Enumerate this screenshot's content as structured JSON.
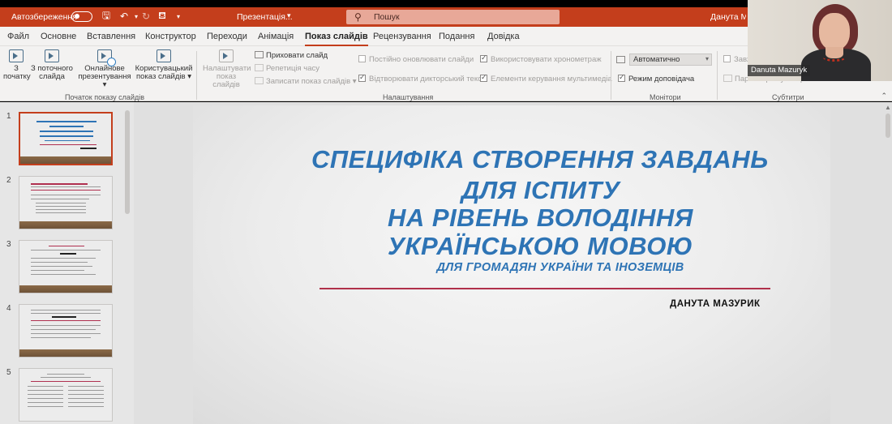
{
  "titlebar": {
    "autosave_label": "Автозбереження",
    "doc_title": "Презентація...",
    "doc_caret": "▾",
    "search_placeholder": "Пошук",
    "user_name": "Данута Мазурик"
  },
  "tabs": [
    {
      "label": "Файл"
    },
    {
      "label": "Основне"
    },
    {
      "label": "Вставлення"
    },
    {
      "label": "Конструктор"
    },
    {
      "label": "Переходи"
    },
    {
      "label": "Анімація"
    },
    {
      "label": "Показ слайдів",
      "active": true
    },
    {
      "label": "Рецензування"
    },
    {
      "label": "Подання"
    },
    {
      "label": "Довідка"
    }
  ],
  "ribbon": {
    "start_group": {
      "from_beginning": "З початку",
      "from_current": "З поточного слайда",
      "online": "Онлайнове презентування",
      "custom": "Користувацький показ слайдів",
      "dropdown_caret": "▾",
      "label": "Початок показу слайдів"
    },
    "setup_group": {
      "setup_show": "Налаштувати показ слайдів",
      "hide_slide": "Приховати слайд",
      "rehearse": "Репетиція часу",
      "record": "Записати показ слайдів",
      "record_caret": "▾",
      "keep_updated": "Постійно оновлювати слайди",
      "play_narrations": "Відтворювати дикторський текст",
      "use_timings": "Використовувати хронометраж",
      "media_controls": "Елементи керування мультимедіа",
      "label": "Налаштування"
    },
    "monitors_group": {
      "monitor_value": "Автоматично",
      "presenter_view": "Режим доповідача",
      "label": "Монітори"
    },
    "subtitles_group": {
      "always_use": "Завж",
      "settings": "Параметри субтитрів",
      "label": "Субтитри"
    }
  },
  "thumbnails": [
    {
      "number": "1",
      "selected": true
    },
    {
      "number": "2"
    },
    {
      "number": "3"
    },
    {
      "number": "4"
    },
    {
      "number": "5"
    }
  ],
  "slide": {
    "title_lines": [
      "СПЕЦИФІКА СТВОРЕННЯ ЗАВДАНЬ",
      "ДЛЯ ІСПИТУ",
      "НА РІВЕНЬ ВОЛОДІННЯ",
      "УКРАЇНСЬКОЮ МОВОЮ"
    ],
    "subtitle": "ДЛЯ ГРОМАДЯН УКРАЇНИ  ТА ІНОЗЕМЦІВ",
    "author": "ДАНУТА МАЗУРИК"
  },
  "webcam": {
    "name": "Danuta Mazuryk"
  },
  "colors": {
    "accent": "#c43e1c",
    "slide_title": "#2e74b5",
    "rule": "#b0304a"
  }
}
